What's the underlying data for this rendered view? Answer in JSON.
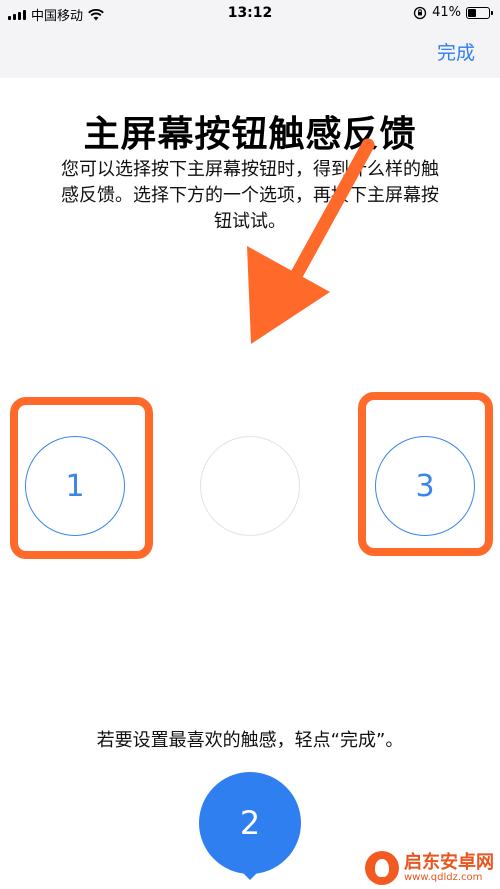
{
  "status_bar": {
    "carrier": "中国移动",
    "time": "13:12",
    "battery": "41%",
    "battery_level": 0.41,
    "icons": [
      "signal-icon",
      "wifi-icon",
      "orientation-lock-icon",
      "battery-icon"
    ]
  },
  "nav": {
    "done_label": "完成"
  },
  "main": {
    "title": "主屏幕按钮触感反馈",
    "description": "您可以选择按下主屏幕按钮时，得到什么样的触感反馈。选择下方的一个选项，再按下主屏幕按钮试试。",
    "options": [
      {
        "label": "1"
      },
      {
        "label": ""
      },
      {
        "label": "3"
      }
    ],
    "instruction": "若要设置最喜欢的触感，轻点“完成”。",
    "selected_option": "2"
  },
  "annotation": {
    "color": "#ff6a2a"
  },
  "accent": "#2f7ff0",
  "watermark": {
    "name": "启东安卓网",
    "url": "www.qdldz.com"
  }
}
